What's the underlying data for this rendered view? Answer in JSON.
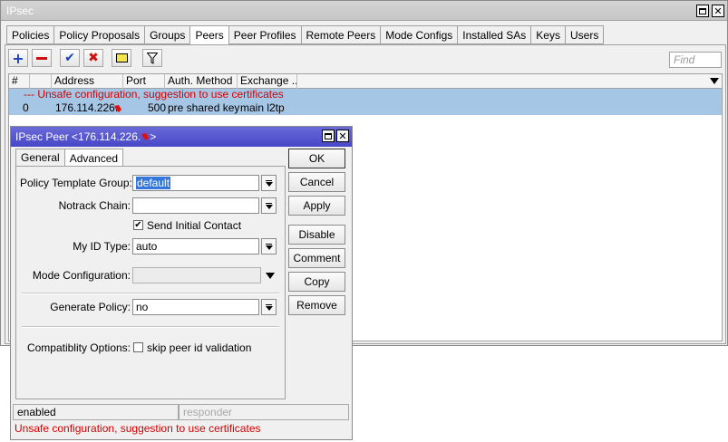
{
  "main_window": {
    "title": "IPsec",
    "tabs": [
      "Policies",
      "Policy Proposals",
      "Groups",
      "Peers",
      "Peer Profiles",
      "Remote Peers",
      "Mode Configs",
      "Installed SAs",
      "Keys",
      "Users"
    ],
    "active_tab": "Peers",
    "find_placeholder": "Find",
    "columns": [
      "#",
      "Address",
      "Port",
      "Auth. Method",
      "Exchange ..."
    ],
    "warning_row": "--- Unsafe configuration, suggestion to use certificates",
    "rows": [
      {
        "num": "0",
        "address": "176.114.226.",
        "port": "500",
        "auth_method": "pre shared key",
        "exchange": "main l2tp"
      }
    ],
    "icons": [
      "add-icon",
      "remove-icon",
      "enable-icon",
      "disable-icon",
      "comment-icon",
      "filter-icon"
    ],
    "colors": {
      "selection": "#a6c6e6",
      "warning_text": "#d40000"
    }
  },
  "dialog": {
    "title": "IPsec Peer <176.114.226.",
    "title_suffix": ">",
    "tabs": [
      "General",
      "Advanced"
    ],
    "active_tab": "Advanced",
    "fields": {
      "policy_template_group": {
        "label": "Policy Template Group:",
        "value": "default"
      },
      "notrack_chain": {
        "label": "Notrack Chain:",
        "value": ""
      },
      "send_initial_contact": {
        "label": "Send Initial Contact",
        "checked": true
      },
      "my_id_type": {
        "label": "My ID Type:",
        "value": "auto"
      },
      "mode_configuration": {
        "label": "Mode Configuration:",
        "value": ""
      },
      "generate_policy": {
        "label": "Generate Policy:",
        "value": "no"
      },
      "compatibility_options": {
        "label": "Compatiblity Options:",
        "option": "skip peer id validation",
        "checked": false
      }
    },
    "buttons": {
      "ok": "OK",
      "cancel": "Cancel",
      "apply": "Apply",
      "disable": "Disable",
      "comment": "Comment",
      "copy": "Copy",
      "remove": "Remove"
    },
    "status": {
      "state": "enabled",
      "role": "responder",
      "warning": "Unsafe configuration, suggestion to use certificates"
    },
    "colors": {
      "titlebar": "#4747c8",
      "selection": "#3377dd"
    }
  }
}
